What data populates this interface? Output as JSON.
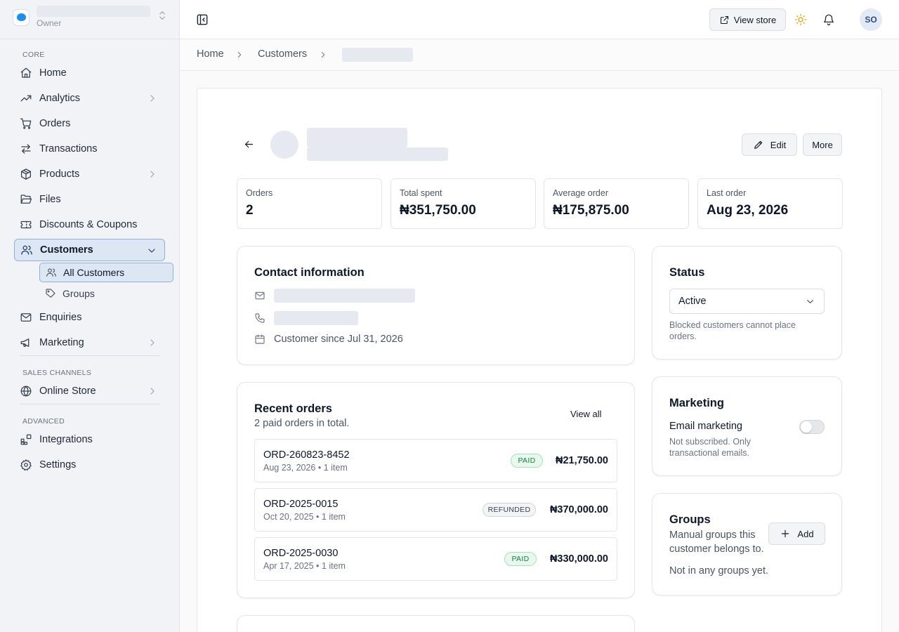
{
  "workspace": {
    "role": "Owner"
  },
  "sidebar": {
    "sections": {
      "core": "CORE",
      "sales": "SALES CHANNELS",
      "advanced": "ADVANCED"
    },
    "items": {
      "home": "Home",
      "analytics": "Analytics",
      "orders": "Orders",
      "transactions": "Transactions",
      "products": "Products",
      "files": "Files",
      "discounts": "Discounts & Coupons",
      "customers": "Customers",
      "all_customers": "All Customers",
      "groups": "Groups",
      "enquiries": "Enquiries",
      "marketing": "Marketing",
      "online_store": "Online Store",
      "integrations": "Integrations",
      "settings": "Settings"
    }
  },
  "header": {
    "view_store": "View store",
    "avatar_initials": "SO"
  },
  "breadcrumb": {
    "home": "Home",
    "customers": "Customers"
  },
  "customer_header": {
    "edit": "Edit",
    "more": "More"
  },
  "stats": [
    {
      "label": "Orders",
      "value": "2"
    },
    {
      "label": "Total spent",
      "value": "₦351,750.00"
    },
    {
      "label": "Average order",
      "value": "₦175,875.00"
    },
    {
      "label": "Last order",
      "value": "Aug 23, 2026"
    }
  ],
  "contact": {
    "title": "Contact information",
    "since": "Customer since Jul 31, 2026"
  },
  "recent_orders": {
    "title": "Recent orders",
    "subtitle": "2 paid orders in total.",
    "view_all": "View all",
    "orders": [
      {
        "id": "ORD-260823-8452",
        "meta": "Aug 23, 2026 • 1 item",
        "status": "PAID",
        "amount": "₦21,750.00"
      },
      {
        "id": "ORD-2025-0015",
        "meta": "Oct 20, 2025 • 1 item",
        "status": "REFUNDED",
        "amount": "₦370,000.00"
      },
      {
        "id": "ORD-2025-0030",
        "meta": "Apr 17, 2025 • 1 item",
        "status": "PAID",
        "amount": "₦330,000.00"
      }
    ]
  },
  "status_card": {
    "title": "Status",
    "value": "Active",
    "help": "Blocked customers cannot place orders."
  },
  "marketing_card": {
    "title": "Marketing",
    "label": "Email marketing",
    "help": "Not subscribed. Only transactional emails.",
    "enabled": false
  },
  "groups_card": {
    "title": "Groups",
    "desc": "Manual groups this customer belongs to.",
    "add": "Add",
    "empty": "Not in any groups yet."
  },
  "colors": {
    "accent": "#1d8fe8",
    "active_bg": "#dde6f3",
    "active_border": "#8fb0da",
    "paid": "#15803d",
    "sun": "#e0a100"
  }
}
